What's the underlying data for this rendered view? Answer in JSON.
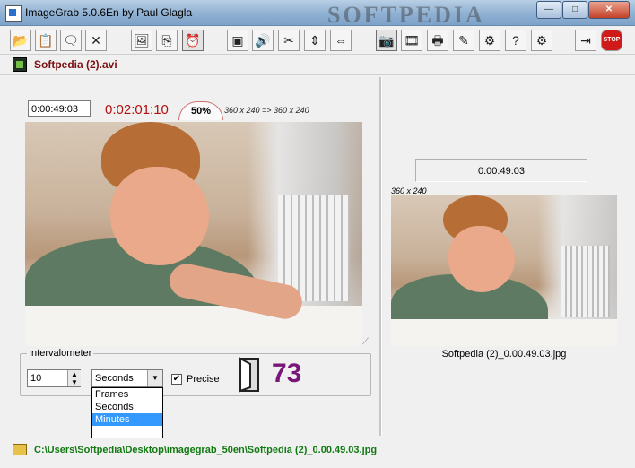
{
  "window": {
    "title": "ImageGrab 5.0.6En by Paul Glagla",
    "watermark": "SOFTPEDIA"
  },
  "window_controls": {
    "minimize": "—",
    "maximize": "□",
    "close": "✕"
  },
  "toolbar": {
    "buttons": [
      {
        "name": "open-file-button",
        "icon": "folder-open-icon",
        "glyph": "📂"
      },
      {
        "name": "paste-button",
        "icon": "paste-icon",
        "glyph": "📋"
      },
      {
        "name": "comment-button",
        "icon": "speech-bubble-icon",
        "glyph": "🗨"
      },
      {
        "name": "close-file-button",
        "icon": "x-icon",
        "glyph": "✕"
      },
      {
        "name": "save-image-button",
        "icon": "image-icon",
        "glyph": "🖼"
      },
      {
        "name": "copy-button",
        "icon": "copy-icon",
        "glyph": "⎘"
      },
      {
        "name": "timer-button",
        "icon": "alarm-clock-icon",
        "glyph": "⏰"
      },
      {
        "name": "fullscreen-button",
        "icon": "monitor-icon",
        "glyph": "▣"
      },
      {
        "name": "sound-button",
        "icon": "speaker-icon",
        "glyph": "🔊"
      },
      {
        "name": "effects-button",
        "icon": "magic-wand-icon",
        "glyph": "✂"
      },
      {
        "name": "fit-vertical-button",
        "icon": "vertical-arrows-icon",
        "glyph": "⇕"
      },
      {
        "name": "fit-horizontal-button",
        "icon": "horizontal-arrows-icon",
        "glyph": "⇔"
      },
      {
        "name": "capture-button",
        "icon": "camera-icon",
        "glyph": "📷"
      },
      {
        "name": "film-button",
        "icon": "film-strip-icon",
        "glyph": "🎞"
      },
      {
        "name": "print-button",
        "icon": "printer-icon",
        "glyph": "🖶"
      },
      {
        "name": "edit-button",
        "icon": "paint-icon",
        "glyph": "✎"
      },
      {
        "name": "settings-button",
        "icon": "settings-icon",
        "glyph": "⚙"
      },
      {
        "name": "help-button",
        "icon": "help-icon",
        "glyph": "?"
      },
      {
        "name": "plugins-button",
        "icon": "plugin-gear-icon",
        "glyph": "⚙"
      },
      {
        "name": "exit-button",
        "icon": "exit-door-icon",
        "glyph": "⇥"
      },
      {
        "name": "stop-button",
        "icon": "stop-sign-icon",
        "glyph": "STOP"
      }
    ]
  },
  "file": {
    "name": "Softpedia (2).avi"
  },
  "player": {
    "position": "0:00:49:03",
    "duration": "0:02:01:10",
    "zoom": "50%",
    "resolution": "360 x 240  =>  360 x 240"
  },
  "intervalometer": {
    "legend": "Intervalometer",
    "value": "10",
    "unit": "Seconds",
    "options": [
      "Frames",
      "Seconds",
      "Minutes"
    ],
    "highlighted_option": "Minutes",
    "precise_label": "Precise",
    "precise_checked": true,
    "counter": "73"
  },
  "capture": {
    "time": "0:00:49:03",
    "resolution": "360 x 240",
    "filename": "Softpedia (2)_0.00.49.03.jpg"
  },
  "status": {
    "path": "C:\\Users\\Softpedia\\Desktop\\imagegrab_50en\\Softpedia (2)_0.00.49.03.jpg"
  }
}
